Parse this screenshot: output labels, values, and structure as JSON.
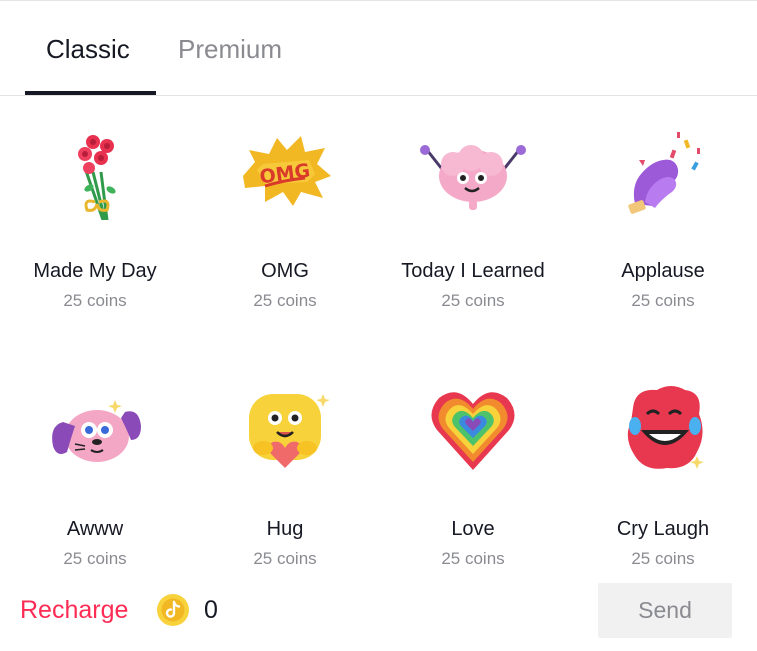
{
  "tabs": [
    {
      "label": "Classic",
      "active": true
    },
    {
      "label": "Premium",
      "active": false
    }
  ],
  "gifts": [
    {
      "name": "Made My Day",
      "price": "25 coins",
      "icon": "rose-bouquet-icon"
    },
    {
      "name": "OMG",
      "price": "25 coins",
      "icon": "omg-splash-icon"
    },
    {
      "name": "Today I Learned",
      "price": "25 coins",
      "icon": "brain-icon"
    },
    {
      "name": "Applause",
      "price": "25 coins",
      "icon": "clapping-hands-icon"
    },
    {
      "name": "Awww",
      "price": "25 coins",
      "icon": "puppy-face-icon"
    },
    {
      "name": "Hug",
      "price": "25 coins",
      "icon": "hugging-face-icon"
    },
    {
      "name": "Love",
      "price": "25 coins",
      "icon": "rainbow-heart-icon"
    },
    {
      "name": "Cry Laugh",
      "price": "25 coins",
      "icon": "cry-laugh-face-icon"
    }
  ],
  "footer": {
    "recharge_label": "Recharge",
    "coin_icon": "tiktok-coin-icon",
    "balance": "0",
    "send_label": "Send"
  },
  "colors": {
    "accent": "#fe2c55",
    "text": "#161823",
    "muted": "#8a8b91",
    "send_bg": "#f1f1f2",
    "coin": "#f7d23a"
  }
}
